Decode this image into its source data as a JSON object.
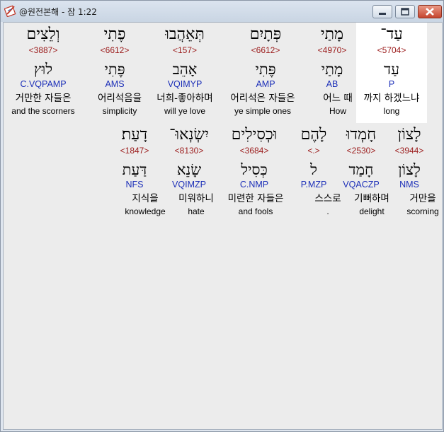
{
  "window": {
    "title": "@원전본해 - 잠 1:22"
  },
  "icons": {
    "app": "book-pen-icon",
    "minimize": "minimize-icon",
    "maximize": "maximize-icon",
    "close": "close-icon"
  },
  "colors": {
    "strong": "#9b1b1b",
    "parse": "#1c2fb8",
    "selected_bg": "#ffffff"
  },
  "words": [
    {
      "heb": "עַד־",
      "strong": "<5704>",
      "lemma": "עַד",
      "parse": "P",
      "kor": "까지 하겠느냐",
      "eng": "long",
      "selected": true
    },
    {
      "heb": "מָתַי",
      "strong": "<4970>",
      "lemma": "מָתַי",
      "parse": "AB",
      "kor": "어느 때",
      "eng": "How"
    },
    {
      "heb": "פְּתָיִם",
      "strong": "<6612>",
      "lemma": "פֶּתִי",
      "parse": "AMP",
      "kor": "어리석은 자들은",
      "eng": "ye simple ones"
    },
    {
      "heb": "תְּאֵהֲבוּ",
      "strong": "<157>",
      "lemma": "אָהֵב",
      "parse": "VQIMYP",
      "kor": "너희-좋아하며",
      "eng": "will ye love"
    },
    {
      "heb": "פֶתִי",
      "strong": "<6612>",
      "lemma": "פֶּתִי",
      "parse": "AMS",
      "kor": "어리석음을",
      "eng": "simplicity"
    },
    {
      "heb": "וְלֵצִים",
      "strong": "<3887>",
      "lemma": "לוּץ",
      "parse": "C.VQPAMP",
      "kor": "거만한 자들은",
      "eng": "and the scorners"
    },
    {
      "heb": "לָצוֹן",
      "strong": "<3944>",
      "lemma": "לָצוֹן",
      "parse": "NMS",
      "kor": "거만을",
      "eng": "scorning"
    },
    {
      "heb": "חָמְדוּ",
      "strong": "<2530>",
      "lemma": "חָמַד",
      "parse": "VQACZP",
      "kor": "기뻐하며",
      "eng": "delight"
    },
    {
      "heb": "לָהֶם",
      "strong": "<.>",
      "lemma": "ל",
      "parse": "P.MZP",
      "kor": "스스로",
      "eng": "."
    },
    {
      "heb": "וּכְסִילִים",
      "strong": "<3684>",
      "lemma": "כְּסִיל",
      "parse": "C.NMP",
      "kor": "미련한 자들은",
      "eng": "and fools"
    },
    {
      "heb": "יִשְׂנְאוּ־",
      "strong": "<8130>",
      "lemma": "שָׂנֵא",
      "parse": "VQIMZP",
      "kor": "미워하니",
      "eng": "hate"
    },
    {
      "heb": "דָעַת׃",
      "strong": "<1847>",
      "lemma": "דַּעַת",
      "parse": "NFS",
      "kor": "지식을",
      "eng": "knowledge"
    }
  ]
}
